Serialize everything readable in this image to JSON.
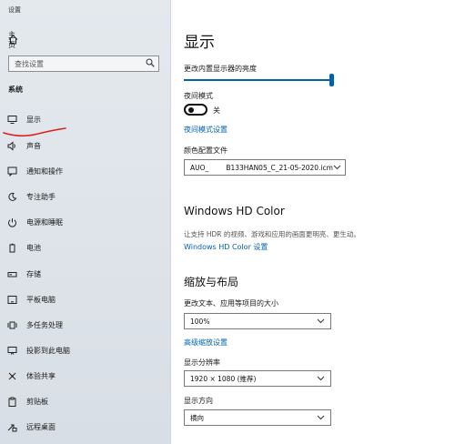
{
  "sidebar": {
    "window_title": "设置",
    "home_label": "主页",
    "search_placeholder": "查找设置",
    "section_title": "系统",
    "items": [
      {
        "label": "显示",
        "icon": "monitor-icon"
      },
      {
        "label": "声音",
        "icon": "speaker-icon"
      },
      {
        "label": "通知和操作",
        "icon": "notification-icon"
      },
      {
        "label": "专注助手",
        "icon": "moon-icon"
      },
      {
        "label": "电源和睡眠",
        "icon": "power-icon"
      },
      {
        "label": "电池",
        "icon": "battery-icon"
      },
      {
        "label": "存储",
        "icon": "storage-icon"
      },
      {
        "label": "平板电脑",
        "icon": "tablet-icon"
      },
      {
        "label": "多任务处理",
        "icon": "multitask-icon"
      },
      {
        "label": "投影到此电脑",
        "icon": "project-icon"
      },
      {
        "label": "体验共享",
        "icon": "share-icon"
      },
      {
        "label": "剪贴板",
        "icon": "clipboard-icon"
      },
      {
        "label": "远程桌面",
        "icon": "remote-icon"
      }
    ],
    "accent_color": "#0063b1",
    "annotation_color": "#e01e1e"
  },
  "main": {
    "title": "显示",
    "brightness_label": "更改内置显示器的亮度",
    "brightness_value": 1.0,
    "night_mode_label": "夜间模式",
    "night_mode_state": "关",
    "night_mode_link": "夜间模式设置",
    "color_profile_label": "颜色配置文件",
    "color_profile_value": "AUO_        B133HAN05_C_21-05-2020.icm",
    "hd_color_title": "Windows HD Color",
    "hd_color_desc": "让支持 HDR 的视频、游戏和应用的画面更明亮、更生动。",
    "hd_color_link": "Windows HD Color 设置",
    "layout_title": "缩放与布局",
    "scale_label": "更改文本、应用等项目的大小",
    "scale_value": "100%",
    "advanced_scale_link": "高级缩放设置",
    "resolution_label": "显示分辨率",
    "resolution_value": "1920 × 1080 (推荐)",
    "orientation_label": "显示方向",
    "orientation_value": "横向"
  }
}
